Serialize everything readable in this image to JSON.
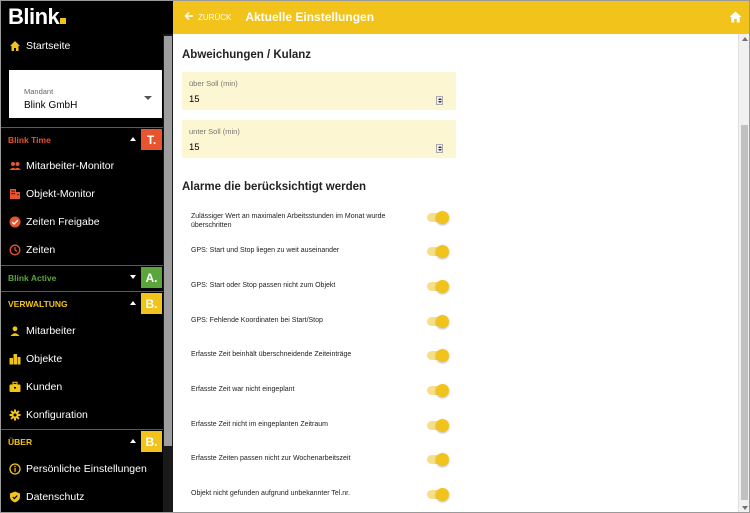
{
  "app": {
    "logo": "Blink",
    "brand_color": "#f2c31a"
  },
  "sidebar": {
    "home": {
      "label": "Startseite",
      "icon": "home-icon"
    },
    "mandant": {
      "label": "Mandant",
      "value": "Blink GmbH"
    },
    "sections": {
      "time": {
        "label": "Blink Time",
        "badge": "T.",
        "color": "#e8542e",
        "items": [
          {
            "label": "Mitarbeiter-Monitor",
            "icon": "people-icon"
          },
          {
            "label": "Objekt-Monitor",
            "icon": "building-icon"
          },
          {
            "label": "Zeiten Freigabe",
            "icon": "check-circle-icon"
          },
          {
            "label": "Zeiten",
            "icon": "clock-icon"
          }
        ]
      },
      "active": {
        "label": "Blink Active",
        "badge": "A.",
        "color": "#5aa63c"
      },
      "verwaltung": {
        "label": "VERWALTUNG",
        "badge": "B.",
        "color": "#f2c31a",
        "items": [
          {
            "label": "Mitarbeiter",
            "icon": "person-icon"
          },
          {
            "label": "Objekte",
            "icon": "city-icon"
          },
          {
            "label": "Kunden",
            "icon": "briefcase-icon"
          },
          {
            "label": "Konfiguration",
            "icon": "gear-icon"
          }
        ]
      },
      "ueber": {
        "label": "ÜBER",
        "badge": "B.",
        "color": "#f2c31a",
        "items": [
          {
            "label": "Persönliche Einstellungen",
            "icon": "info-icon"
          },
          {
            "label": "Datenschutz",
            "icon": "shield-icon"
          }
        ]
      }
    }
  },
  "header": {
    "back_label": "ZURÜCK",
    "title": "Aktuelle Einstellungen"
  },
  "main": {
    "section1_title": "Abweichungen / Kulanz",
    "fields": [
      {
        "label": "über Soll (min)",
        "value": "15"
      },
      {
        "label": "unter Soll (min)",
        "value": "15"
      }
    ],
    "section2_title": "Alarme die berücksichtigt werden",
    "alarms": [
      {
        "label": "Zulässiger Wert an maximalen Arbeitsstunden im Monat wurde überschritten",
        "on": true
      },
      {
        "label": "GPS: Start und Stop liegen zu weit auseinander",
        "on": true
      },
      {
        "label": "GPS: Start oder Stop passen nicht zum Objekt",
        "on": true
      },
      {
        "label": "GPS: Fehlende Koordinaten bei Start/Stop",
        "on": true
      },
      {
        "label": "Erfasste Zeit beinhält überschneidende Zeiteinträge",
        "on": true
      },
      {
        "label": "Erfasste Zeit war nicht eingeplant",
        "on": true
      },
      {
        "label": "Erfasste Zeit nicht im eingeplanten Zeitraum",
        "on": true
      },
      {
        "label": "Erfasste Zeiten passen nicht zur Wochenarbeitszeit",
        "on": true
      },
      {
        "label": "Objekt nicht gefunden aufgrund unbekannter Tel.nr.",
        "on": true
      }
    ]
  }
}
